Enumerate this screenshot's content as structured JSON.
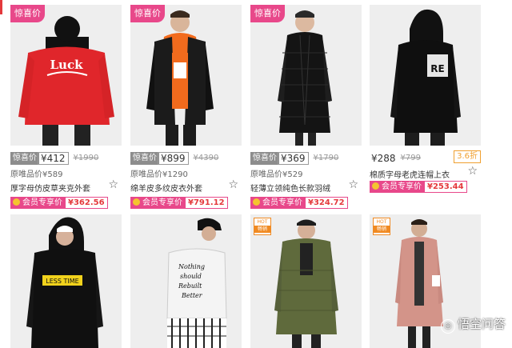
{
  "row1": [
    {
      "tag": "惊喜价",
      "label": "惊喜价",
      "price": "¥412",
      "old": "¥1990",
      "orig": "原唯品价¥589",
      "name": "厚字母仿皮草夹克外套",
      "vip_label": "会员专享价",
      "vip_price": "¥362.56"
    },
    {
      "tag": "惊喜价",
      "label": "惊喜价",
      "price": "¥899",
      "old": "¥4390",
      "orig": "原唯品价¥1290",
      "name": "绵羊皮多纹皮衣外套",
      "vip_label": "会员专享价",
      "vip_price": "¥791.12"
    },
    {
      "tag": "惊喜价",
      "label": "惊喜价",
      "price": "¥369",
      "old": "¥1790",
      "orig": "原唯品价¥529",
      "name": "轻薄立领纯色长款羽绒",
      "vip_label": "会员专享价",
      "vip_price": "¥324.72"
    },
    {
      "price": "¥288",
      "old": "¥799",
      "discount": "3.6折",
      "name": "棉质字母老虎连帽上衣",
      "vip_label": "会员专享价",
      "vip_price": "¥253.44"
    }
  ],
  "row2_hot": {
    "top": "HOT",
    "bottom": "畅销"
  },
  "star_icon": "☆",
  "watermark": "悟空问答",
  "colors": {
    "accent": "#e8488a",
    "price_red": "#e4393c",
    "discount": "#f0a030"
  }
}
